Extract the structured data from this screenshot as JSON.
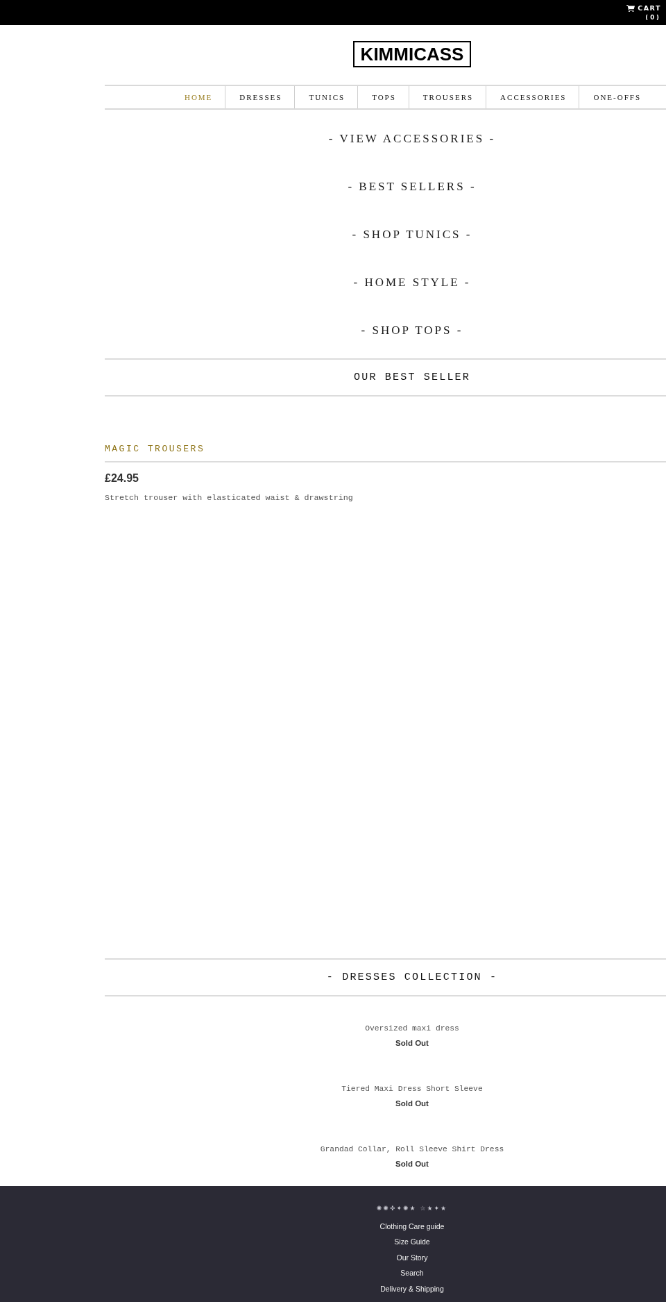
{
  "top_bar": {
    "cart_label": "CART",
    "cart_count": "(0)"
  },
  "logo": {
    "text": "KIMMICASS"
  },
  "nav": [
    {
      "label": "HOME",
      "selected": true
    },
    {
      "label": "DRESSES",
      "selected": false
    },
    {
      "label": "TUNICS",
      "selected": false
    },
    {
      "label": "TOPS",
      "selected": false
    },
    {
      "label": "TROUSERS",
      "selected": false
    },
    {
      "label": "ACCESSORIES",
      "selected": false
    },
    {
      "label": "ONE-OFFS",
      "selected": false
    }
  ],
  "section_links": [
    "- VIEW ACCESSORIES -",
    "- BEST SELLERS -",
    "- SHOP TUNICS -",
    "- HOME STYLE -",
    "- SHOP TOPS -"
  ],
  "best_seller": {
    "heading": "OUR BEST SELLER",
    "product": {
      "name": "MAGIC TROUSERS",
      "price": "£24.95",
      "description": "Stretch trouser with elasticated waist & drawstring"
    }
  },
  "collection": {
    "heading": "- DRESSES COLLECTION -",
    "products": [
      {
        "name": "Oversized maxi dress",
        "status": "Sold Out"
      },
      {
        "name": "Tiered Maxi Dress Short Sleeve",
        "status": "Sold Out"
      },
      {
        "name": "Grandad Collar, Roll Sleeve Shirt Dress",
        "status": "Sold Out"
      }
    ]
  },
  "footer": {
    "decoration": "✺✺✜✦✺★ ☆★✦★",
    "links": [
      "Clothing Care guide",
      "Size Guide",
      "Our Story",
      "Search",
      "Delivery & Shipping"
    ]
  }
}
